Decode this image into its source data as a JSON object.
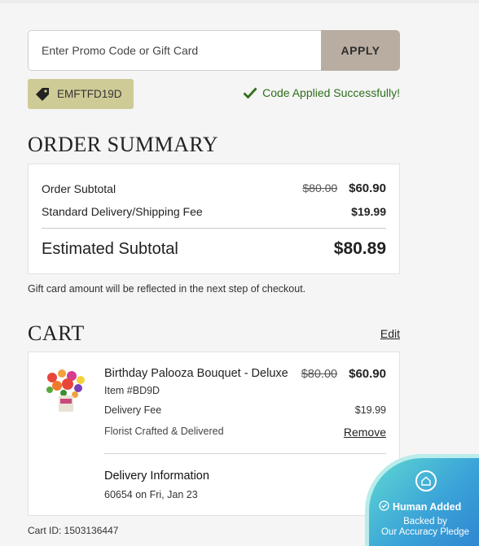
{
  "promo": {
    "placeholder": "Enter Promo Code or Gift Card",
    "apply_label": "APPLY",
    "applied_code": "EMFTFD19D",
    "success_message": "Code Applied Successfully!"
  },
  "order_summary": {
    "title": "ORDER SUMMARY",
    "subtotal_label": "Order Subtotal",
    "subtotal_original": "$80.00",
    "subtotal_price": "$60.90",
    "shipping_label": "Standard Delivery/Shipping Fee",
    "shipping_price": "$19.99",
    "estimated_label": "Estimated Subtotal",
    "estimated_price": "$80.89",
    "gift_note": "Gift card amount will be reflected in the next step of checkout."
  },
  "cart": {
    "title": "CART",
    "edit_label": "Edit",
    "item": {
      "name": "Birthday Palooza Bouquet - Deluxe",
      "original_price": "$80.00",
      "price": "$60.90",
      "item_number": "Item #BD9D",
      "delivery_fee_label": "Delivery Fee",
      "delivery_fee": "$19.99",
      "crafted_label": "Florist Crafted & Delivered",
      "remove_label": "Remove"
    },
    "delivery_title": "Delivery Information",
    "delivery_info": "60654 on Fri, Jan 23",
    "cart_id": "Cart ID: 1503136447"
  },
  "badge": {
    "title": "Human Added",
    "line1": "Backed by",
    "line2": "Our Accuracy Pledge"
  },
  "colors": {
    "apply_button": "#b9ada2",
    "code_chip": "#cfcb97",
    "success_green": "#2f6e1c",
    "badge_start": "#5fd8d2",
    "badge_end": "#2f84d0"
  }
}
